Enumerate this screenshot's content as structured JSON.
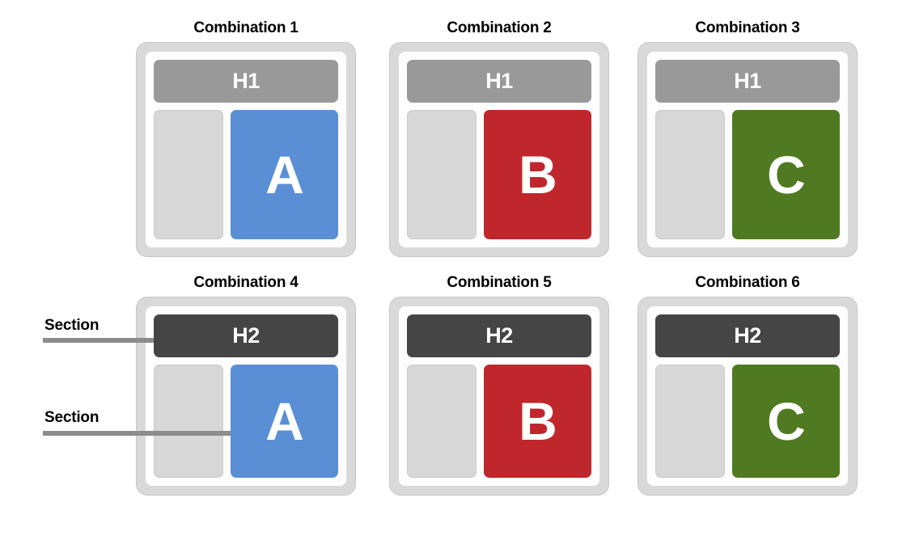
{
  "diagram": {
    "title_prefix": "Combination",
    "colors": {
      "blue": "#5a8fd6",
      "red": "#c0272d",
      "green": "#4f7a21",
      "header_light": "#999999",
      "header_dark": "#454545",
      "side_panel": "#d7d7d7",
      "device_frame": "#d9d9d9",
      "screen": "#fdfdfd",
      "arrow": "#8c8c8c",
      "text_on_block": "#ffffff",
      "title_text": "#000000"
    },
    "cards": [
      {
        "title": "Combination 1",
        "header_label": "H1",
        "header_variant": "light",
        "block_label": "A",
        "block_color": "#5a8fd6",
        "side_panel_label": ""
      },
      {
        "title": "Combination 2",
        "header_label": "H1",
        "header_variant": "light",
        "block_label": "B",
        "block_color": "#c0272d",
        "side_panel_label": ""
      },
      {
        "title": "Combination 3",
        "header_label": "H1",
        "header_variant": "light",
        "block_label": "C",
        "block_color": "#4f7a21",
        "side_panel_label": ""
      },
      {
        "title": "Combination 4",
        "header_label": "H2",
        "header_variant": "dark",
        "block_label": "A",
        "block_color": "#5a8fd6",
        "side_panel_label": ""
      },
      {
        "title": "Combination 5",
        "header_label": "H2",
        "header_variant": "dark",
        "block_label": "B",
        "block_color": "#c0272d",
        "side_panel_label": ""
      },
      {
        "title": "Combination 6",
        "header_label": "H2",
        "header_variant": "dark",
        "block_label": "C",
        "block_color": "#4f7a21",
        "side_panel_label": ""
      }
    ],
    "annotations": [
      {
        "label": "Section",
        "target": "H2 header bar of Combination 4"
      },
      {
        "label": "Section",
        "target": "A content block of Combination 4"
      }
    ]
  }
}
